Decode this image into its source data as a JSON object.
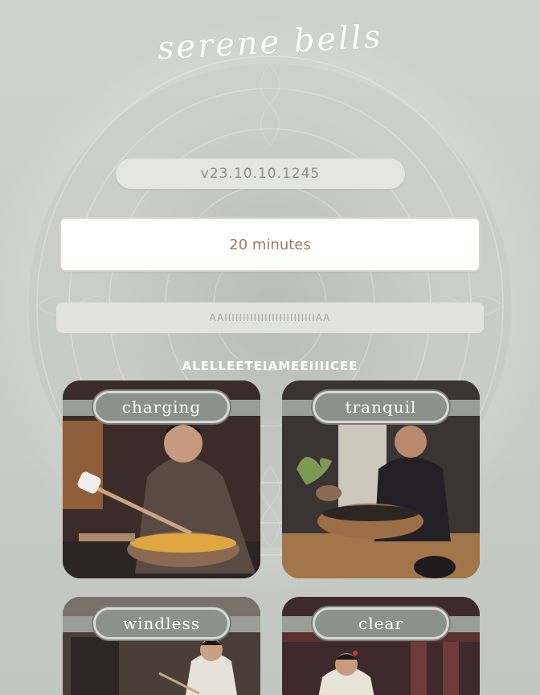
{
  "app": {
    "title": "serene bells"
  },
  "version": {
    "label": "v23.10.10.1245"
  },
  "timer": {
    "duration": "20 minutes"
  },
  "start_bar": {
    "label": "AAIIIIIIIIIIIIIIIIIIIIIIIIIAA"
  },
  "sounds": {
    "heading": "ALELLEETEIAMEEIIIICEE",
    "items": [
      {
        "label": "charging",
        "icon": "bell-player-woman-mallet-image"
      },
      {
        "label": "tranquil",
        "icon": "bell-player-elder-image"
      },
      {
        "label": "windless",
        "icon": "bell-player-woman-standing-image"
      },
      {
        "label": "clear",
        "icon": "bell-player-woman-temple-image"
      }
    ]
  },
  "colors": {
    "background": "#c9ccc6",
    "title": "#ffffff",
    "version_text": "#8a8f88",
    "duration_text": "#a07a5c",
    "card_label_bg": "#8d918b"
  }
}
